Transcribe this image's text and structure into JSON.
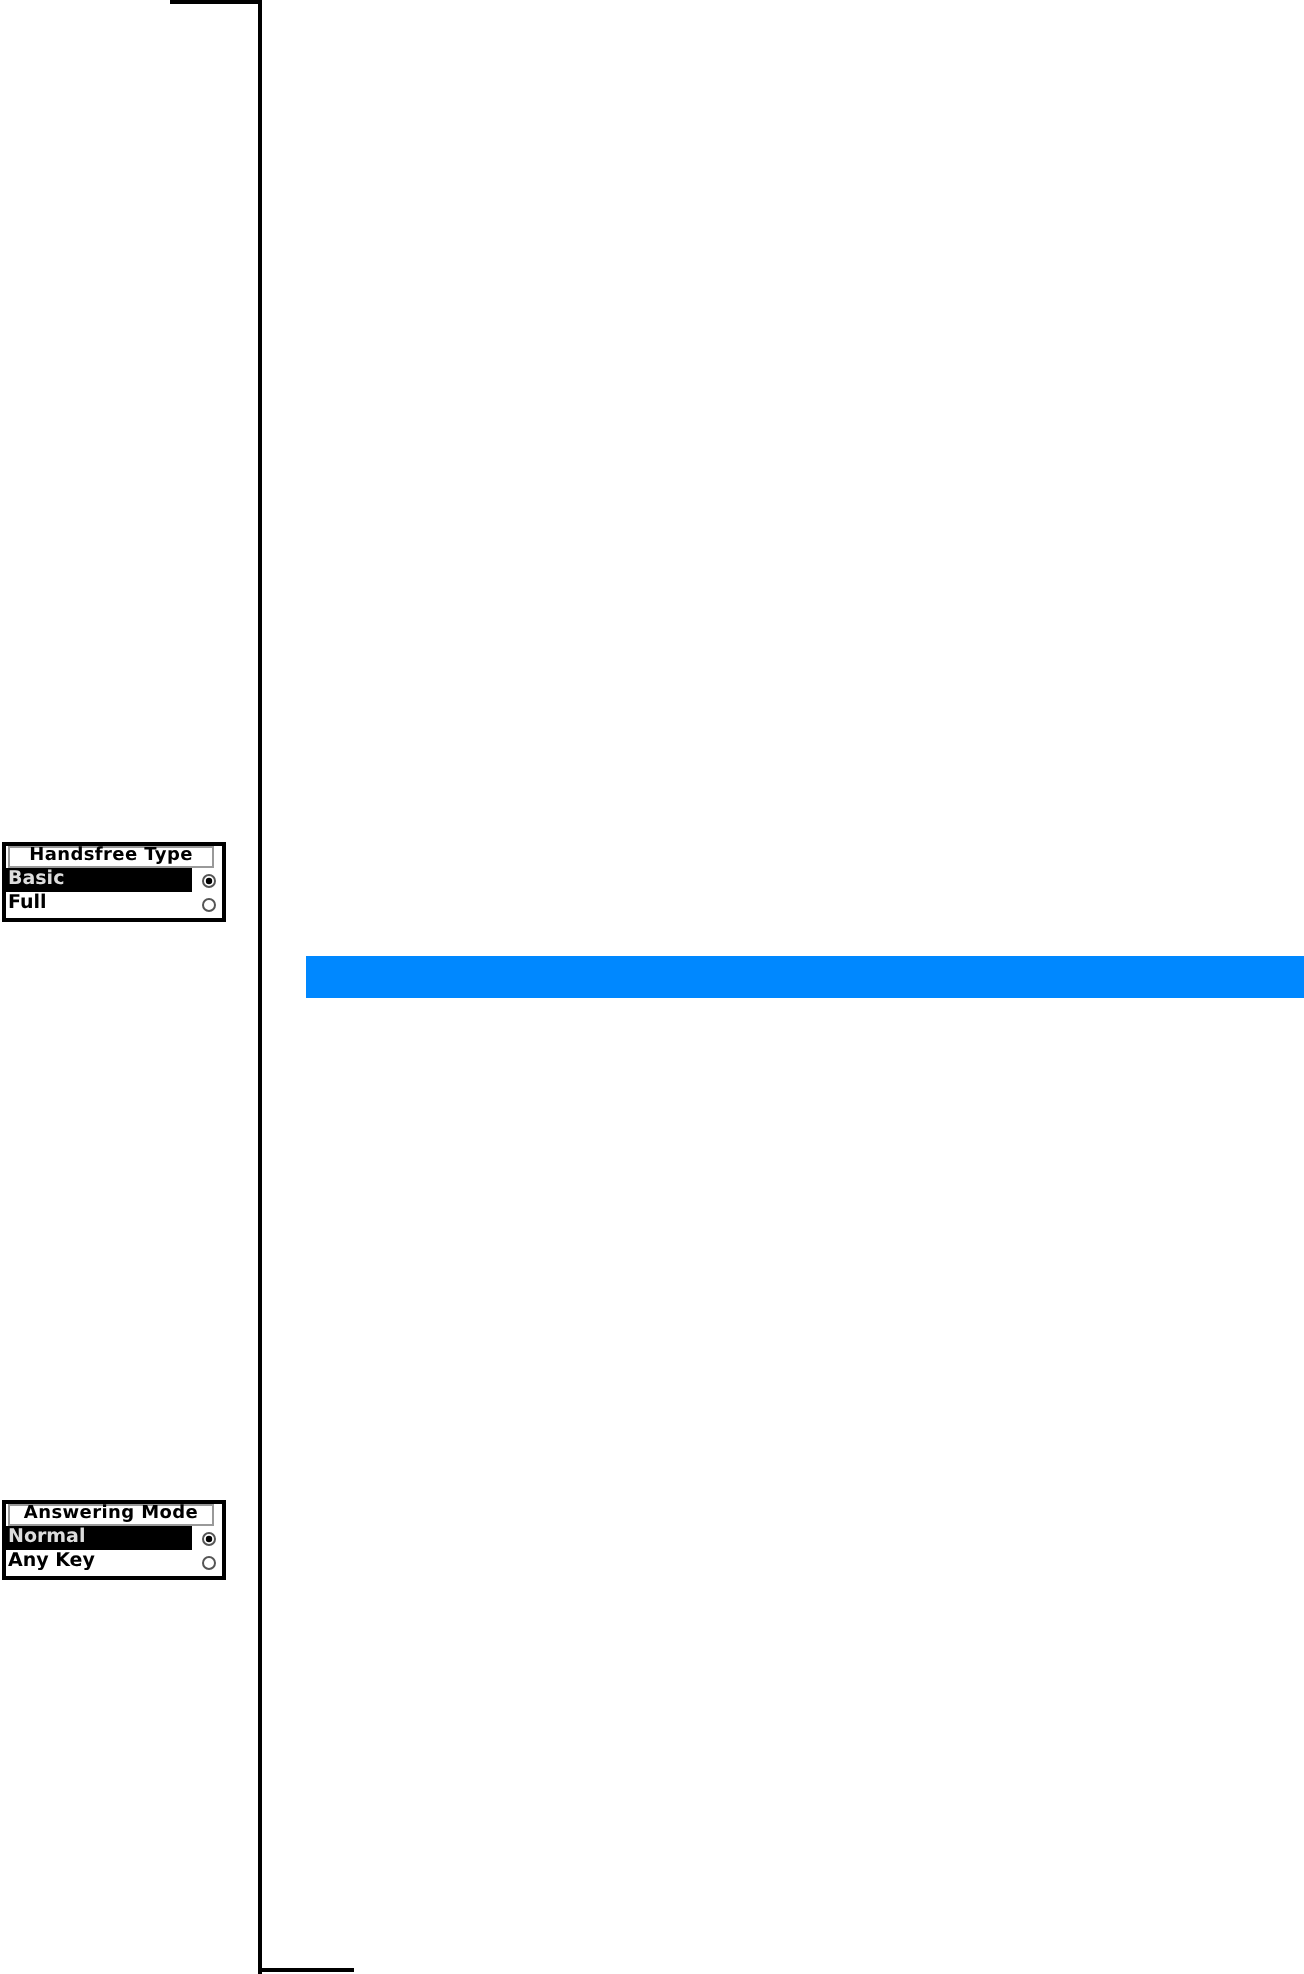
{
  "screens": [
    {
      "title": "Handsfree Type",
      "options": [
        {
          "label": "Basic",
          "selected": true
        },
        {
          "label": "Full",
          "selected": false
        }
      ]
    },
    {
      "title": "Answering Mode",
      "options": [
        {
          "label": "Normal",
          "selected": true
        },
        {
          "label": "Any Key",
          "selected": false
        }
      ]
    }
  ]
}
